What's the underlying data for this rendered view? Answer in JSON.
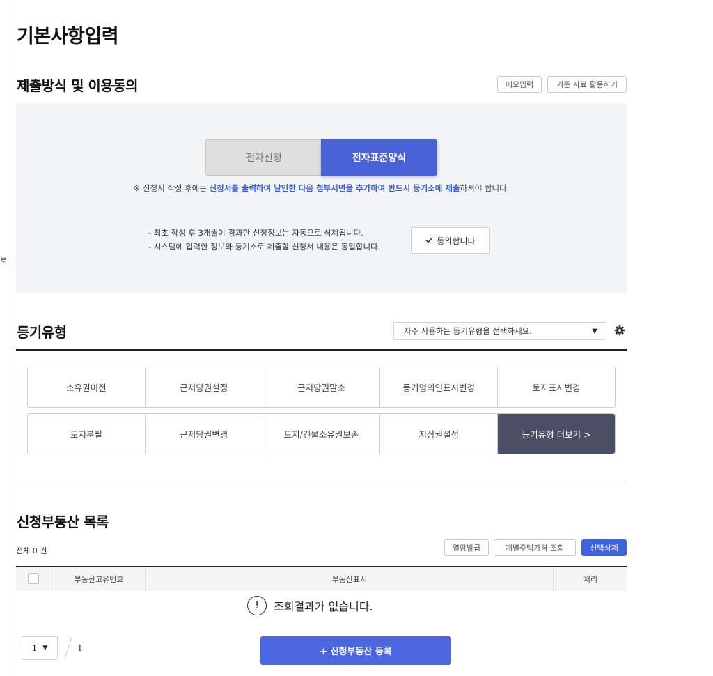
{
  "page": {
    "title": "기본사항입력",
    "stray_char": "로"
  },
  "submission": {
    "title": "제출방식 및 이용동의",
    "memo_button": "메모입력",
    "reuse_button": "기존 자료 활용하기",
    "toggle_electronic": "전자신청",
    "toggle_standard": "전자표준양식",
    "notice_prefix": "※ 신청서 작성 후에는 ",
    "notice_highlight": "신청서를 출력하여 날인한 다음 첨부서면을 추가하여 반드시 등기소에 제출",
    "notice_suffix": "하셔야 합니다.",
    "consent_line1": "- 최초 작성 후 3개월이 경과한 신청정보는 자동으로 삭제됩니다.",
    "consent_line2": "- 시스템에 입력한 정보와 등기소로 제출할 신청서 내용은 동일합니다.",
    "agree_button": "동의합니다"
  },
  "registration_type": {
    "title": "등기유형",
    "select_placeholder": "자주 사용하는 등기유형을 선택하세요.",
    "row1": [
      "소유권이전",
      "근저당권설정",
      "근저당권말소",
      "등기명의인표시변경",
      "토지표시변경"
    ],
    "row2": [
      "토지분필",
      "근저당권변경",
      "토지/건물소유권보존",
      "지상권설정"
    ],
    "more_button": "등기유형 더보기 >"
  },
  "property_list": {
    "title": "신청부동산 목록",
    "total": "전체 0 건",
    "btn_view": "열람발급",
    "btn_price": "개별주택가격 조회",
    "btn_delete": "선택삭제",
    "col_id": "부동산고유번호",
    "col_display": "부동산표시",
    "col_action": "처리",
    "empty_message": "조회결과가 없습니다.",
    "page_size": "1",
    "total_pages": "1",
    "register_button": "+ 신청부동산 등록"
  }
}
